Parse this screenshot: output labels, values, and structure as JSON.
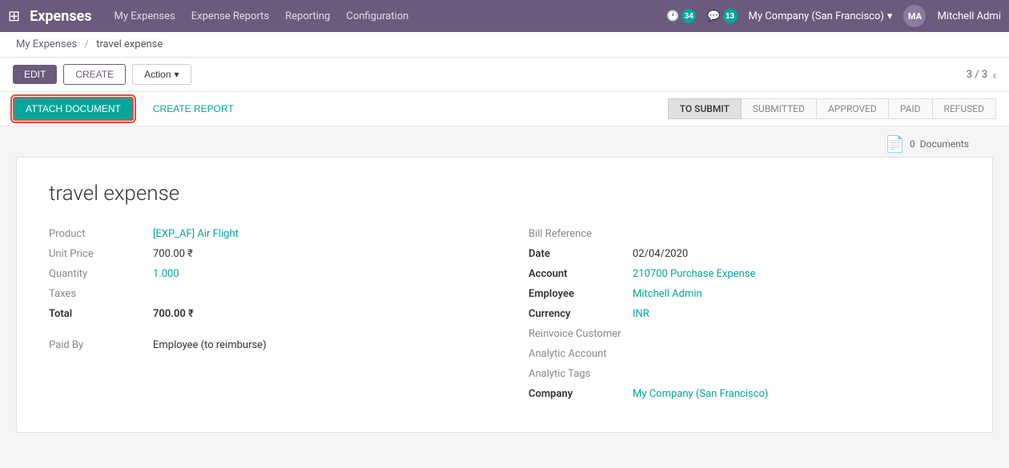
{
  "topnav": {
    "app_title": "Expenses",
    "nav_links": [
      {
        "label": "My Expenses",
        "id": "my-expenses"
      },
      {
        "label": "Expense Reports",
        "id": "expense-reports"
      },
      {
        "label": "Reporting",
        "id": "reporting"
      },
      {
        "label": "Configuration",
        "id": "configuration"
      }
    ],
    "badge_clock": "34",
    "badge_chat": "13",
    "company": "My Company (San Francisco)",
    "user": "Mitchell Admi"
  },
  "breadcrumb": {
    "parent": "My Expenses",
    "separator": "/",
    "current": "travel expense"
  },
  "toolbar": {
    "edit_label": "EDIT",
    "create_label": "CREATE",
    "action_label": "Action",
    "pagination": "3 / 3"
  },
  "toolbar2": {
    "attach_label": "ATTACH DOCUMENT",
    "create_report_label": "CREATE REPORT"
  },
  "status_steps": [
    {
      "label": "TO SUBMIT",
      "active": true
    },
    {
      "label": "SUBMITTED",
      "active": false
    },
    {
      "label": "APPROVED",
      "active": false
    },
    {
      "label": "PAID",
      "active": false
    },
    {
      "label": "REFUSED",
      "active": false
    }
  ],
  "documents": {
    "count": "0",
    "label": "Documents"
  },
  "form": {
    "title": "travel expense",
    "left_fields": [
      {
        "label": "Product",
        "value": "[EXP_AF] Air Flight",
        "type": "link"
      },
      {
        "label": "Unit Price",
        "value": "700.00 ₹",
        "type": "text"
      },
      {
        "label": "Quantity",
        "value": "1.000",
        "type": "link"
      },
      {
        "label": "Taxes",
        "value": "",
        "type": "muted"
      },
      {
        "label": "Total",
        "value": "700.00 ₹",
        "type": "bold"
      }
    ],
    "right_fields": [
      {
        "label": "Bill Reference",
        "value": "",
        "type": "muted"
      },
      {
        "label": "Date",
        "value": "02/04/2020",
        "type": "text"
      },
      {
        "label": "Account",
        "value": "210700 Purchase Expense",
        "type": "link"
      },
      {
        "label": "Employee",
        "value": "Mitchell Admin",
        "type": "link"
      },
      {
        "label": "Currency",
        "value": "INR",
        "type": "link"
      },
      {
        "label": "Reinvoice Customer",
        "value": "",
        "type": "muted"
      },
      {
        "label": "Analytic Account",
        "value": "",
        "type": "muted"
      },
      {
        "label": "Analytic Tags",
        "value": "",
        "type": "muted"
      },
      {
        "label": "Company",
        "value": "My Company (San Francisco)",
        "type": "link"
      }
    ],
    "paid_by_label": "Paid By",
    "paid_by_value": "Employee (to reimburse)"
  }
}
